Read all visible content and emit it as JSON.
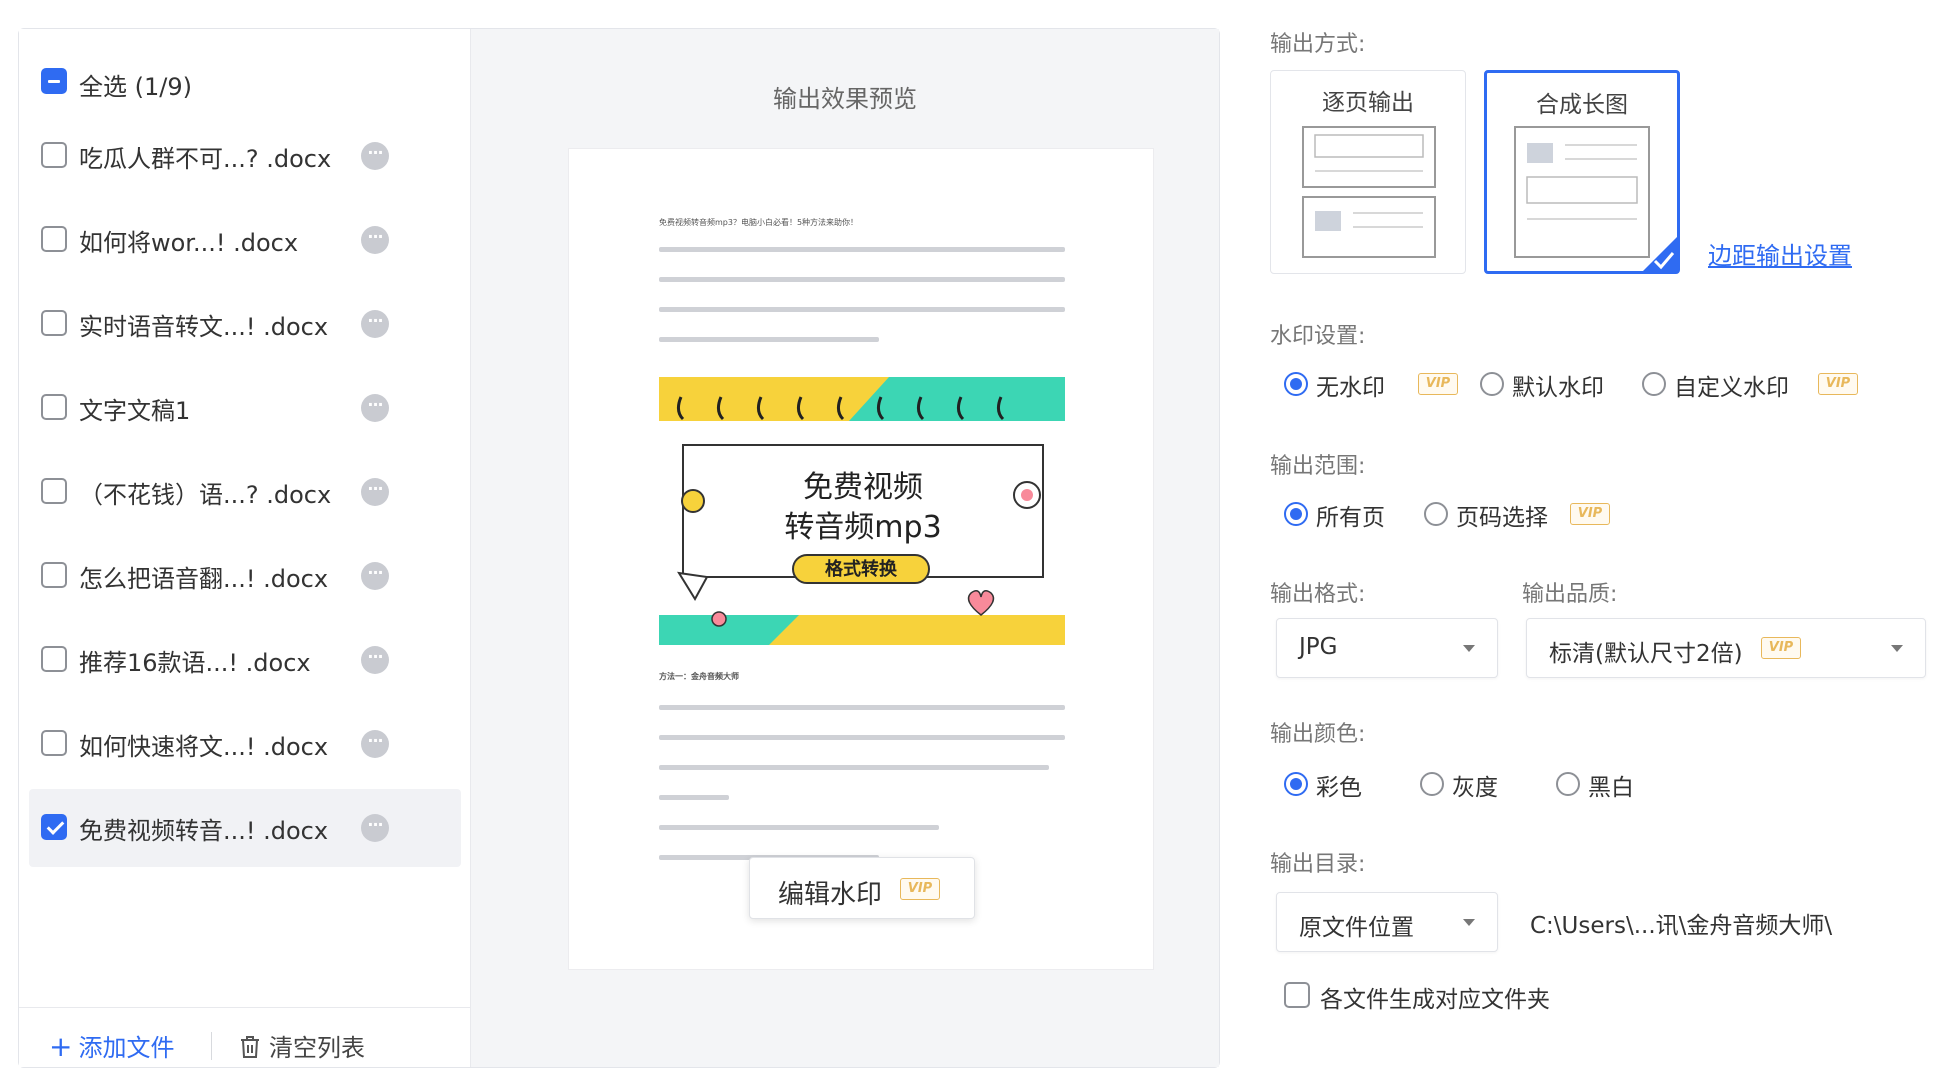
{
  "file_list": {
    "select_all": "全选 (1/9)",
    "files": [
      {
        "name": "吃瓜人群不可...? .docx",
        "checked": false
      },
      {
        "name": "如何将wor...! .docx",
        "checked": false
      },
      {
        "name": "实时语音转文...! .docx",
        "checked": false
      },
      {
        "name": "文字文稿1",
        "checked": false
      },
      {
        "name": "（不花钱）语...? .docx",
        "checked": false
      },
      {
        "name": "怎么把语音翻...! .docx",
        "checked": false
      },
      {
        "name": "推荐16款语...! .docx",
        "checked": false
      },
      {
        "name": "如何快速将文...! .docx",
        "checked": false
      },
      {
        "name": "免费视频转音...! .docx",
        "checked": true
      }
    ],
    "more_icon": "···",
    "add_file": "添加文件",
    "clear_list": "清空列表"
  },
  "preview": {
    "title": "输出效果预览",
    "doc_heading": "免费视频转音频mp3？电脑小白必看！5种方法来助你！",
    "banner_line1": "免费视频",
    "banner_line2": "转音频mp3",
    "banner_tag": "格式转换",
    "section_title": "方法一：金舟音频大师",
    "edit_watermark": "编辑水印"
  },
  "settings": {
    "output_mode_label": "输出方式:",
    "mode_per_page": "逐页输出",
    "mode_long_image": "合成长图",
    "margin_link": "边距输出设置",
    "watermark_label": "水印设置:",
    "wm_none": "无水印",
    "wm_default": "默认水印",
    "wm_custom": "自定义水印",
    "range_label": "输出范围:",
    "range_all": "所有页",
    "range_pages": "页码选择",
    "format_label": "输出格式:",
    "format_value": "JPG",
    "quality_label": "输出品质:",
    "quality_value": "标清(默认尺寸2倍)",
    "color_label": "输出颜色:",
    "color_full": "彩色",
    "color_gray": "灰度",
    "color_bw": "黑白",
    "dir_label": "输出目录:",
    "dir_value": "原文件位置",
    "dir_path": "C:\\Users\\...讯\\金舟音频大师\\",
    "per_file_folder": "各文件生成对应文件夹",
    "vip": "VIP"
  },
  "colors": {
    "accent": "#2f6bf2",
    "vip": "#e8b85b",
    "banner_yellow": "#f7d23b",
    "banner_teal": "#3cd6b4"
  }
}
